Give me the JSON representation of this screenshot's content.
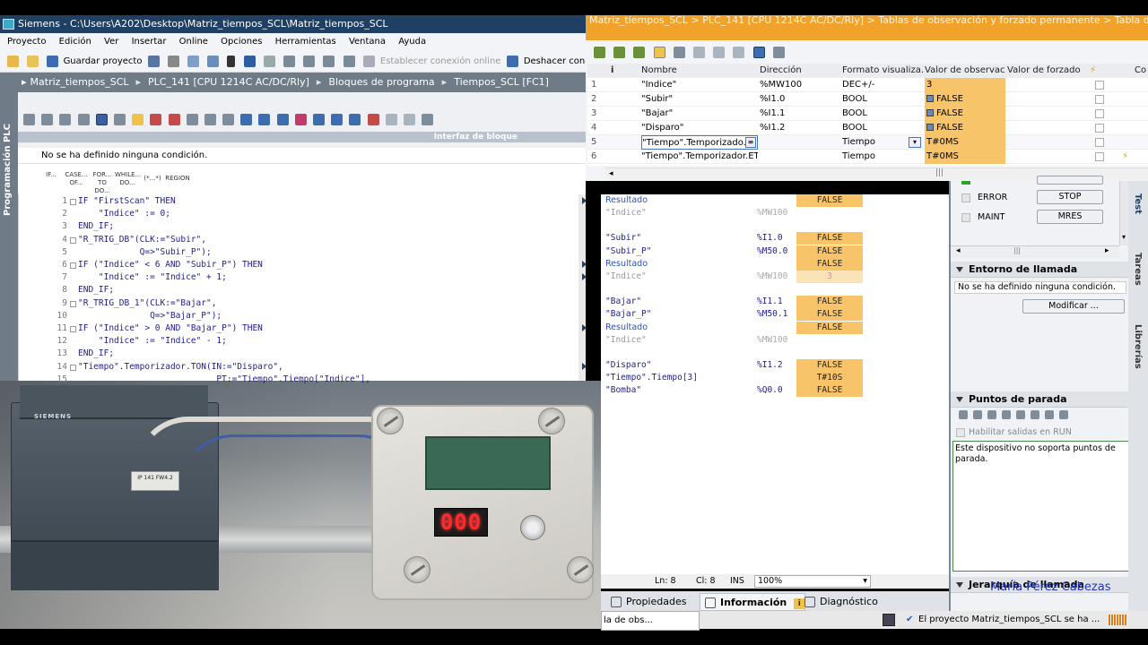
{
  "main_window": {
    "title": "Siemens  -  C:\\Users\\A202\\Desktop\\Matriz_tiempos_SCL\\Matriz_tiempos_SCL",
    "menu": [
      "Proyecto",
      "Edición",
      "Ver",
      "Insertar",
      "Online",
      "Opciones",
      "Herramientas",
      "Ventana",
      "Ayuda"
    ],
    "toolbar": {
      "save_project": "Guardar proyecto",
      "connect_online": "Establecer conexión online",
      "disconnect": "Deshacer conex"
    },
    "side_tab": "Programación PLC",
    "breadcrumb": [
      "Matriz_tiempos_SCL",
      "PLC_141 [CPU 1214C AC/DC/Rly]",
      "Bloques de programa",
      "Tiempos_SCL [FC1]"
    ],
    "interface_label": "Interfaz de bloque",
    "condition_text": "No se ha definido ninguna condición.",
    "instructions": [
      "IF...",
      "CASE... OF...",
      "FOR... TO DO...",
      "WHILE... DO...",
      "(*...*)",
      "REGION"
    ],
    "code_lines": [
      {
        "n": "1",
        "t": "IF \"FirstScan\" THEN"
      },
      {
        "n": "2",
        "t": "    \"Indice\" := 0;"
      },
      {
        "n": "3",
        "t": "END_IF;"
      },
      {
        "n": "4",
        "t": "\"R_TRIG_DB\"(CLK:=\"Subir\","
      },
      {
        "n": "5",
        "t": "            Q=>\"Subir_P\");"
      },
      {
        "n": "6",
        "t": "IF (\"Indice\" < 6 AND \"Subir_P\") THEN"
      },
      {
        "n": "7",
        "t": "    \"Indice\" := \"Indice\" + 1;"
      },
      {
        "n": "8",
        "t": "END_IF;"
      },
      {
        "n": "9",
        "t": "\"R_TRIG_DB_1\"(CLK:=\"Bajar\","
      },
      {
        "n": "10",
        "t": "              Q=>\"Bajar_P\");"
      },
      {
        "n": "11",
        "t": "IF (\"Indice\" > 0 AND \"Bajar_P\") THEN"
      },
      {
        "n": "12",
        "t": "    \"Indice\" := \"Indice\" - 1;"
      },
      {
        "n": "13",
        "t": "END_IF;"
      },
      {
        "n": "14",
        "t": "\"Tiempo\".Temporizador.TON(IN:=\"Disparo\","
      },
      {
        "n": "15",
        "t": "                           PT:=\"Tiempo\".Tiempo[\"Indice\"],"
      }
    ]
  },
  "watch": {
    "title_text": "Matriz_tiempos_SCL  >  PLC_141 [CPU 1214C AC/DC/Rly]  >  Tablas de observación y forzado permanente  >  Tabla de obs",
    "headers": {
      "num": "i",
      "name": "Nombre",
      "address": "Dirección",
      "format": "Formato visualiza...",
      "monitor": "Valor de observac...",
      "force": "Valor de forzado",
      "com": "Co"
    },
    "rows": [
      {
        "n": "1",
        "name": "\"Indice\"",
        "addr": "%MW100",
        "fmt": "DEC+/-",
        "val": "3",
        "bool": false
      },
      {
        "n": "2",
        "name": "\"Subir\"",
        "addr": "%I1.0",
        "fmt": "BOOL",
        "val": "FALSE",
        "bool": true
      },
      {
        "n": "3",
        "name": "\"Bajar\"",
        "addr": "%I1.1",
        "fmt": "BOOL",
        "val": "FALSE",
        "bool": true
      },
      {
        "n": "4",
        "name": "\"Disparo\"",
        "addr": "%I1.2",
        "fmt": "BOOL",
        "val": "FALSE",
        "bool": true
      },
      {
        "n": "5",
        "name": "\"Tiempo\".Temporizado...",
        "addr": "",
        "fmt": "Tiempo",
        "val": "T#0MS",
        "bool": false
      },
      {
        "n": "6",
        "name": "\"Tiempo\".Temporizador.ET",
        "addr": "",
        "fmt": "Tiempo",
        "val": "T#0MS",
        "bool": false
      }
    ]
  },
  "monitor": [
    {
      "name": "Resultado",
      "addr": "",
      "val": "FALSE",
      "kind": "res",
      "vk": "o"
    },
    {
      "name": "\"Indice\"",
      "addr": "%MW100",
      "val": "",
      "kind": "gray",
      "vk": ""
    },
    {
      "name": "",
      "addr": "",
      "val": "",
      "kind": "",
      "vk": ""
    },
    {
      "name": "\"Subir\"",
      "addr": "%I1.0",
      "val": "FALSE",
      "kind": "",
      "vk": "o"
    },
    {
      "name": "\"Subir_P\"",
      "addr": "%M50.0",
      "val": "FALSE",
      "kind": "",
      "vk": "o"
    },
    {
      "name": "Resultado",
      "addr": "",
      "val": "FALSE",
      "kind": "res",
      "vk": "o"
    },
    {
      "name": "\"Indice\"",
      "addr": "%MW100",
      "val": "3",
      "kind": "gray",
      "vk": "ol"
    },
    {
      "name": "",
      "addr": "",
      "val": "",
      "kind": "",
      "vk": ""
    },
    {
      "name": "\"Bajar\"",
      "addr": "%I1.1",
      "val": "FALSE",
      "kind": "",
      "vk": "o"
    },
    {
      "name": "\"Bajar_P\"",
      "addr": "%M50.1",
      "val": "FALSE",
      "kind": "",
      "vk": "o"
    },
    {
      "name": "Resultado",
      "addr": "",
      "val": "FALSE",
      "kind": "res",
      "vk": "o"
    },
    {
      "name": "\"Indice\"",
      "addr": "%MW100",
      "val": "",
      "kind": "gray",
      "vk": ""
    },
    {
      "name": "",
      "addr": "",
      "val": "",
      "kind": "",
      "vk": ""
    },
    {
      "name": "\"Disparo\"",
      "addr": "%I1.2",
      "val": "FALSE",
      "kind": "",
      "vk": "o"
    },
    {
      "name": "\"Tiempo\".Tiempo[3]",
      "addr": "",
      "val": "T#10S",
      "kind": "",
      "vk": "o"
    },
    {
      "name": "\"Bomba\"",
      "addr": "%Q0.0",
      "val": "FALSE",
      "kind": "",
      "vk": "o"
    }
  ],
  "status": {
    "line": "Ln: 8",
    "col": "Cl: 8",
    "mode": "INS",
    "zoom": "100%"
  },
  "bottom_tabs": [
    "Propiedades",
    "Información",
    "Diagnóstico"
  ],
  "taskbar": {
    "left": "la de obs...",
    "right": "El proyecto Matriz_tiempos_SCL se ha ..."
  },
  "right_panel": {
    "error": "ERROR",
    "stop": "STOP",
    "maint": "MAINT",
    "mres": "MRES",
    "call_env": "Entorno de llamada",
    "call_env_text": "No se ha definido ninguna condición.",
    "modify": "Modificar ...",
    "breakpoints": "Puntos de parada",
    "enable_outputs": "Habilitar salidas en RUN",
    "bp_text": "Este dispositivo no soporta puntos de parada.",
    "call_hierarchy": "Jerarquía de llamada",
    "tabs": [
      "Test",
      "Tareas",
      "Librerías"
    ]
  },
  "photo": {
    "plc_brand": "SIEMENS",
    "plc_label": "IP 141 FW4.2",
    "display_value": "000"
  },
  "watermark": "María Pérez Cabezas",
  "colors": {
    "monitor_orange": "#f8c46a",
    "title_navy": "#1f3f63",
    "breadcrumb_gray": "#6f7b87",
    "watch_title": "#f0a22b"
  }
}
